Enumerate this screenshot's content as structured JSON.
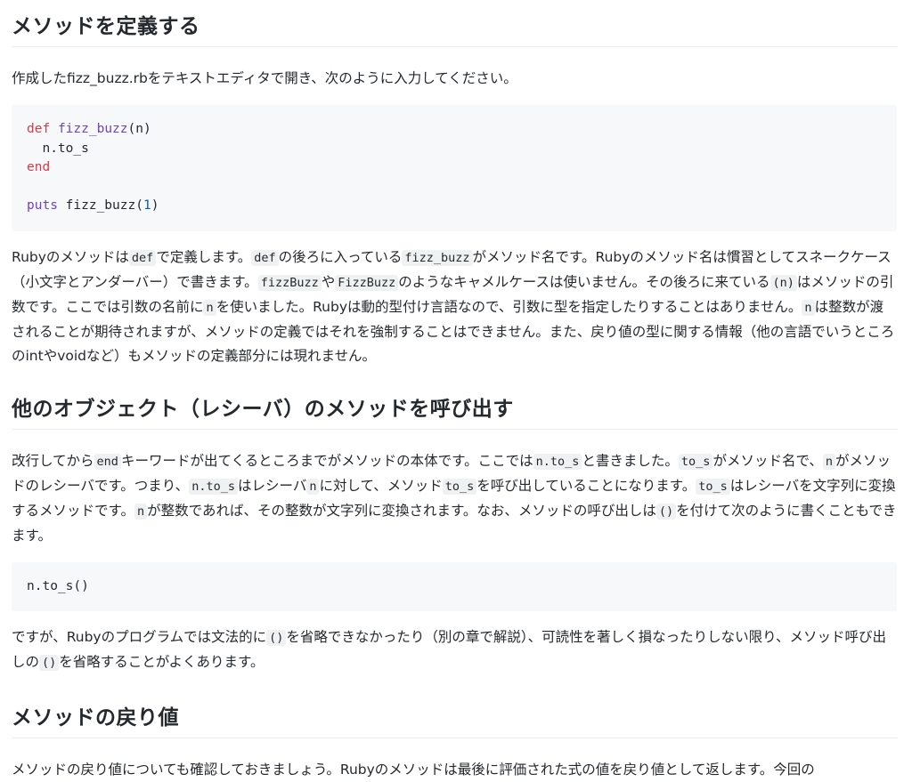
{
  "sections": {
    "define": {
      "heading": "メソッドを定義する",
      "intro": "作成したfizz_buzz.rbをテキストエディタで開き、次のように入力してください。",
      "code": {
        "l1_kw": "def",
        "l1_fn": "fizz_buzz",
        "l1_rest": "(n)",
        "l2": "  n.to_s",
        "l3_kw": "end",
        "l5_kw": "puts",
        "l5_mid": " fizz_buzz(",
        "l5_num": "1",
        "l5_end": ")"
      },
      "para": {
        "t1": "Rubyのメソッドは",
        "c1": "def",
        "t2": "で定義します。",
        "c2": "def",
        "t3": "の後ろに入っている",
        "c3": "fizz_buzz",
        "t4": "がメソッド名です。Rubyのメソッド名は慣習としてスネークケース（小文字とアンダーバー）で書きます。",
        "c4": "fizzBuzz",
        "t5": "や",
        "c5": "FizzBuzz",
        "t6": "のようなキャメルケースは使いません。その後ろに来ている",
        "c6": "(n)",
        "t7": "はメソッドの引数です。ここでは引数の名前に",
        "c7": "n",
        "t8": "を使いました。Rubyは動的型付け言語なので、引数に型を指定したりすることはありません。",
        "c8": "n",
        "t9": "は整数が渡されることが期待されますが、メソッドの定義ではそれを強制することはできません。また、戻り値の型に関する情報（他の言語でいうところのintやvoidなど）もメソッドの定義部分には現れません。"
      }
    },
    "receiver": {
      "heading": "他のオブジェクト（レシーバ）のメソッドを呼び出す",
      "para": {
        "t1": "改行してから",
        "c1": "end",
        "t2": "キーワードが出てくるところまでがメソッドの本体です。ここでは",
        "c2": "n.to_s",
        "t3": "と書きました。",
        "c3": "to_s",
        "t4": "がメソッド名で、",
        "c4": "n",
        "t5": "がメソッドのレシーバです。つまり、",
        "c5": "n.to_s",
        "t6": "はレシーバ",
        "c6": "n",
        "t7": "に対して、メソッド",
        "c7": "to_s",
        "t8": "を呼び出していることになります。",
        "c8": "to_s",
        "t9": "はレシーバを文字列に変換するメソッドです。",
        "c9": "n",
        "t10": "が整数であれば、その整数が文字列に変換されます。なお、メソッドの呼び出しは",
        "c10": "()",
        "t11": "を付けて次のように書くこともできます。"
      },
      "code": "n.to_s()",
      "para2": {
        "t1": "ですが、Rubyのプログラムでは文法的に",
        "c1": "()",
        "t2": "を省略できなかったり（別の章で解説）、可読性を著しく損なったりしない限り、メソッド呼び出しの",
        "c2": "()",
        "t3": "を省略することがよくあります。"
      }
    },
    "return_value": {
      "heading": "メソッドの戻り値",
      "para": "メソッドの戻り値についても確認しておきましょう。Rubyのメソッドは最後に評価された式の値を戻り値として返します。今回の"
    }
  }
}
